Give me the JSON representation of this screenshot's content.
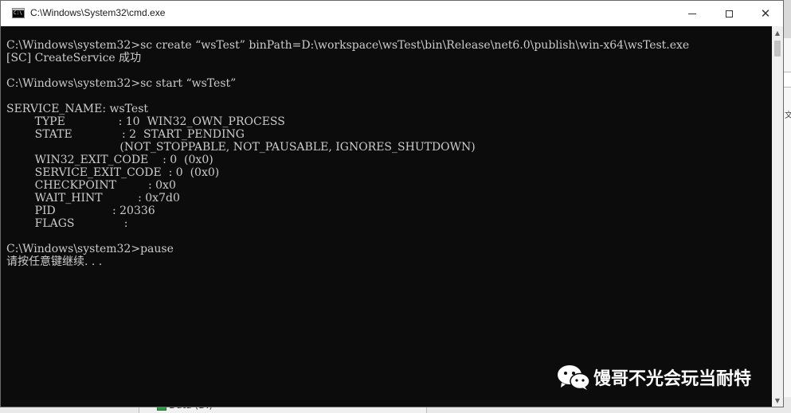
{
  "window": {
    "title": "C:\\Windows\\System32\\cmd.exe",
    "icon": "cmd-icon"
  },
  "console_lines": [
    "C:\\Windows\\system32>sc create “wsTest” binPath=D:\\workspace\\wsTest\\bin\\Release\\net6.0\\publish\\win-x64\\wsTest.exe",
    "[SC] CreateService 成功",
    "",
    "C:\\Windows\\system32>sc start “wsTest”",
    "",
    "SERVICE_NAME: wsTest",
    "        TYPE               : 10  WIN32_OWN_PROCESS",
    "        STATE              : 2  START_PENDING",
    "                                (NOT_STOPPABLE, NOT_PAUSABLE, IGNORES_SHUTDOWN)",
    "        WIN32_EXIT_CODE    : 0  (0x0)",
    "        SERVICE_EXIT_CODE  : 0  (0x0)",
    "        CHECKPOINT         : 0x0",
    "        WAIT_HINT          : 0x7d0",
    "        PID                : 20336",
    "        FLAGS              :",
    "",
    "C:\\Windows\\system32>pause",
    "请按任意键继续. . ."
  ],
  "watermark": {
    "text": "馒哥不光会玩当耐特",
    "icon": "wechat-icon"
  },
  "background": {
    "drive_label": "Data (D:)",
    "side_text": "文"
  },
  "colors": {
    "console_bg": "#0c0c0c",
    "console_text": "#cccccc",
    "titlebar_bg": "#ffffff"
  }
}
